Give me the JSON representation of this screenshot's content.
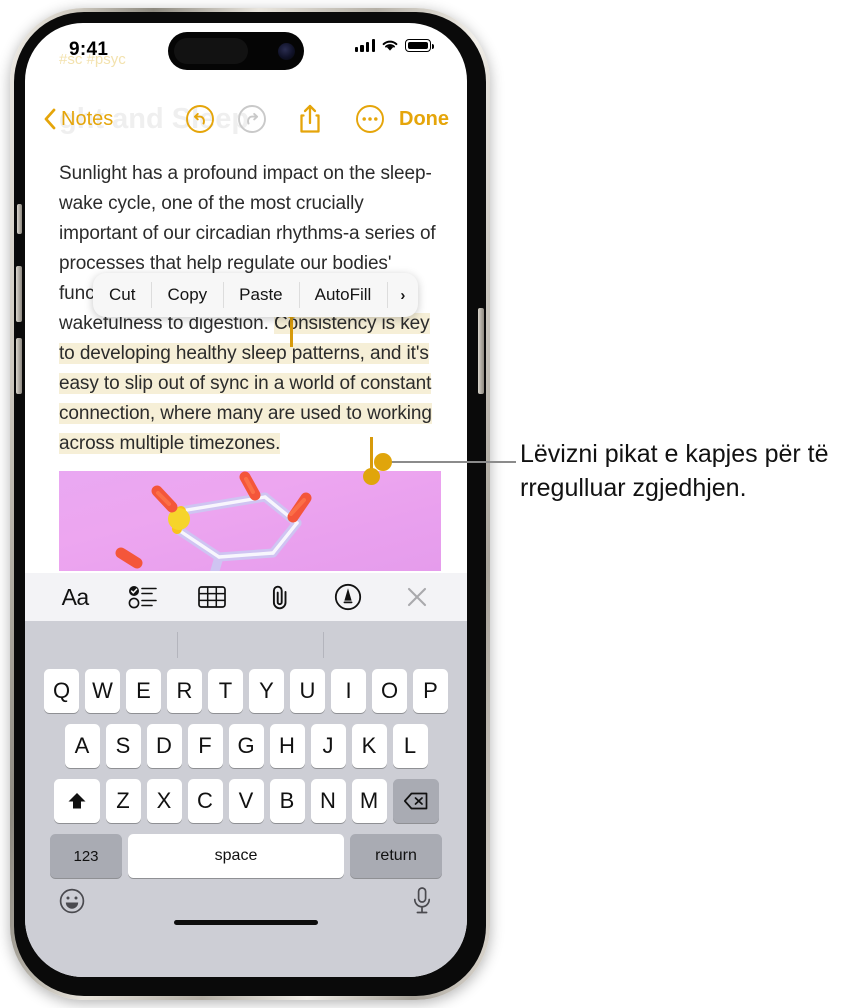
{
  "status_bar": {
    "time": "9:41",
    "signal_icon": "cellular-bars-icon",
    "wifi_icon": "wifi-icon",
    "battery_icon": "battery-full-icon"
  },
  "faded_background": {
    "tags": "#sc #psyc",
    "note_title": "ght and Sleep"
  },
  "nav_bar": {
    "back_label": "Notes",
    "back_icon": "chevron-left-icon",
    "undo_icon": "undo-icon",
    "redo_icon": "redo-icon",
    "share_icon": "share-icon",
    "more_icon": "more-ellipsis-icon",
    "done_label": "Done"
  },
  "note": {
    "paragraph_before": "Sunlight has a profound impact on the sleep-wake cycle, one of the most crucially important of our circadian rhythms-a series of processes that help regulate our bodies' functions to optimize everything from wakefulness to digestion. ",
    "selected_text": "Consistency is key to developing healthy sleep patterns, and it's easy to slip out of sync in a world of constant connection, where many are used to working across multiple timezones.",
    "photo_alt": "molecule-illustration"
  },
  "edit_menu": {
    "items": [
      {
        "label": "Cut",
        "name": "cut"
      },
      {
        "label": "Copy",
        "name": "copy"
      },
      {
        "label": "Paste",
        "name": "paste"
      },
      {
        "label": "AutoFill",
        "name": "autofill"
      },
      {
        "label": "›",
        "name": "more-chevron"
      }
    ]
  },
  "format_toolbar": {
    "items": [
      {
        "label": "Aa",
        "name": "text-format-icon"
      },
      {
        "label": "",
        "name": "checklist-icon"
      },
      {
        "label": "",
        "name": "table-icon"
      },
      {
        "label": "",
        "name": "paperclip-attach-icon"
      },
      {
        "label": "",
        "name": "markup-pen-icon"
      },
      {
        "label": "",
        "name": "close-x-icon"
      }
    ]
  },
  "keyboard": {
    "row1": [
      "Q",
      "W",
      "E",
      "R",
      "T",
      "Y",
      "U",
      "I",
      "O",
      "P"
    ],
    "row2": [
      "A",
      "S",
      "D",
      "F",
      "G",
      "H",
      "J",
      "K",
      "L"
    ],
    "row3": [
      "Z",
      "X",
      "C",
      "V",
      "B",
      "N",
      "M"
    ],
    "shift_icon": "shift-up-arrow-icon",
    "delete_icon": "backspace-delete-icon",
    "numbers_label": "123",
    "space_label": "space",
    "return_label": "return",
    "emoji_icon": "emoji-smiley-icon",
    "dictation_icon": "microphone-icon"
  },
  "annotation": {
    "text": "Lëvizni pikat e kapjes për të rregulluar zgjedhjen."
  },
  "colors": {
    "accent_yellow": "#E5A50A",
    "handle_gold": "#E0A50B",
    "selection_highlight": "#f6efd7",
    "keyboard_bg": "#cdced5",
    "toolbar_bg": "#f3f3f6",
    "photo_pink": "#e9a8f2"
  }
}
